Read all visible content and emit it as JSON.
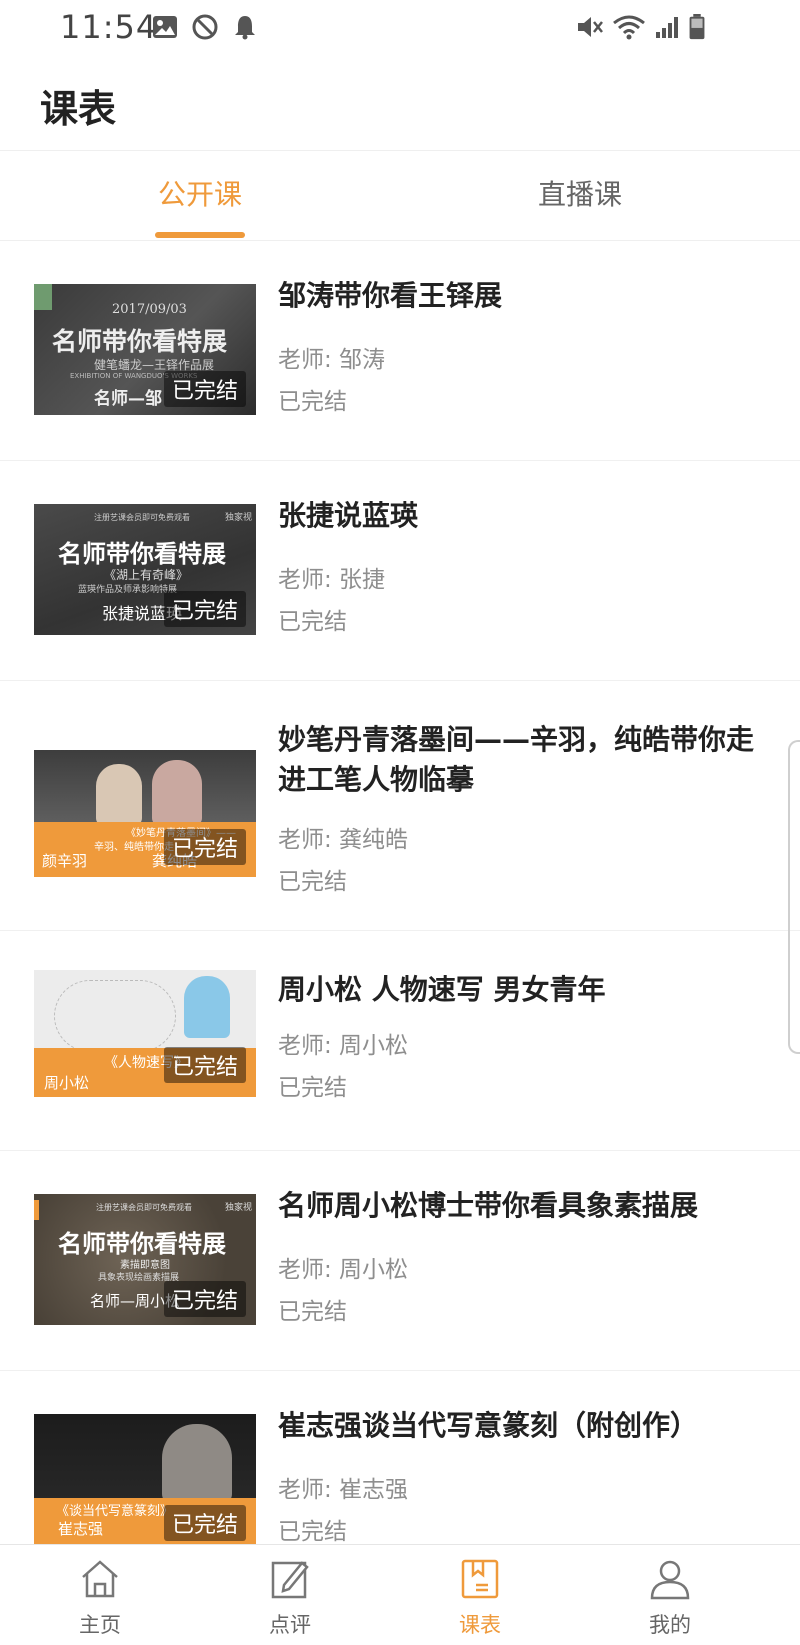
{
  "status_bar": {
    "time": "11:54",
    "icons": [
      "image-icon",
      "nfc-off-icon",
      "bell-icon",
      "mute-icon",
      "wifi-icon",
      "signal-icon",
      "battery-icon"
    ]
  },
  "header": {
    "title": "课表"
  },
  "tabs": [
    {
      "label": "公开课",
      "active": true
    },
    {
      "label": "直播课",
      "active": false
    }
  ],
  "colors": {
    "accent": "#ef9a3b",
    "text": "#222222",
    "muted": "#8e8e8e"
  },
  "courses": [
    {
      "title": "邹涛带你看王铎展",
      "teacher": "老师: 邹涛",
      "status": "已完结",
      "thumb": {
        "date": "2017/09/03",
        "headline": "名师带你看特展",
        "sub": "健笔蟠龙—王铎作品展",
        "en": "EXHIBITION OF WANGDUO'S WORKS",
        "foot": "名师—邹",
        "badge": "已完结"
      }
    },
    {
      "title": "张捷说蓝瑛",
      "teacher": "老师: 张捷",
      "status": "已完结",
      "thumb": {
        "top": "注册艺课会员即可免费观看",
        "tag": "独家视",
        "headline": "名师带你看特展",
        "sub": "《湖上有奇峰》",
        "sub2": "蓝瑛作品及师承影响特展",
        "foot": "张捷说蓝瑛",
        "badge": "已完结"
      }
    },
    {
      "title": "妙笔丹青落墨间——辛羽，纯皓带你走进工笔人物临摹",
      "teacher": "老师: 龚纯皓",
      "status": "已完结",
      "thumb": {
        "line1": "《妙笔丹青落墨间》——",
        "line2": "辛羽、纯皓带你走",
        "name1": "颜辛羽",
        "name2": "龚纯皓",
        "badge": "已完结"
      }
    },
    {
      "title": "周小松 人物速写 男女青年",
      "teacher": "老师: 周小松",
      "status": "已完结",
      "thumb": {
        "line1": "《人物速写》",
        "name": "周小松",
        "badge": "已完结"
      }
    },
    {
      "title": "名师周小松博士带你看具象素描展",
      "teacher": "老师: 周小松",
      "status": "已完结",
      "thumb": {
        "top": "注册艺课会员即可免费观看",
        "tag": "独家视",
        "headline": "名师带你看特展",
        "sub": "素描即意图",
        "sub2": "具象表现绘画素描展",
        "foot": "名师—周小松",
        "badge": "已完结"
      }
    },
    {
      "title": "崔志强谈当代写意篆刻（附创作）",
      "teacher": "老师: 崔志强",
      "status": "已完结",
      "thumb": {
        "line1": "《谈当代写意篆刻》",
        "name": "崔志强",
        "badge": "已完结"
      }
    }
  ],
  "bottom_nav": [
    {
      "label": "主页",
      "icon": "home-icon",
      "active": false
    },
    {
      "label": "点评",
      "icon": "edit-icon",
      "active": false
    },
    {
      "label": "课表",
      "icon": "bookmark-icon",
      "active": true
    },
    {
      "label": "我的",
      "icon": "person-icon",
      "active": false
    }
  ]
}
